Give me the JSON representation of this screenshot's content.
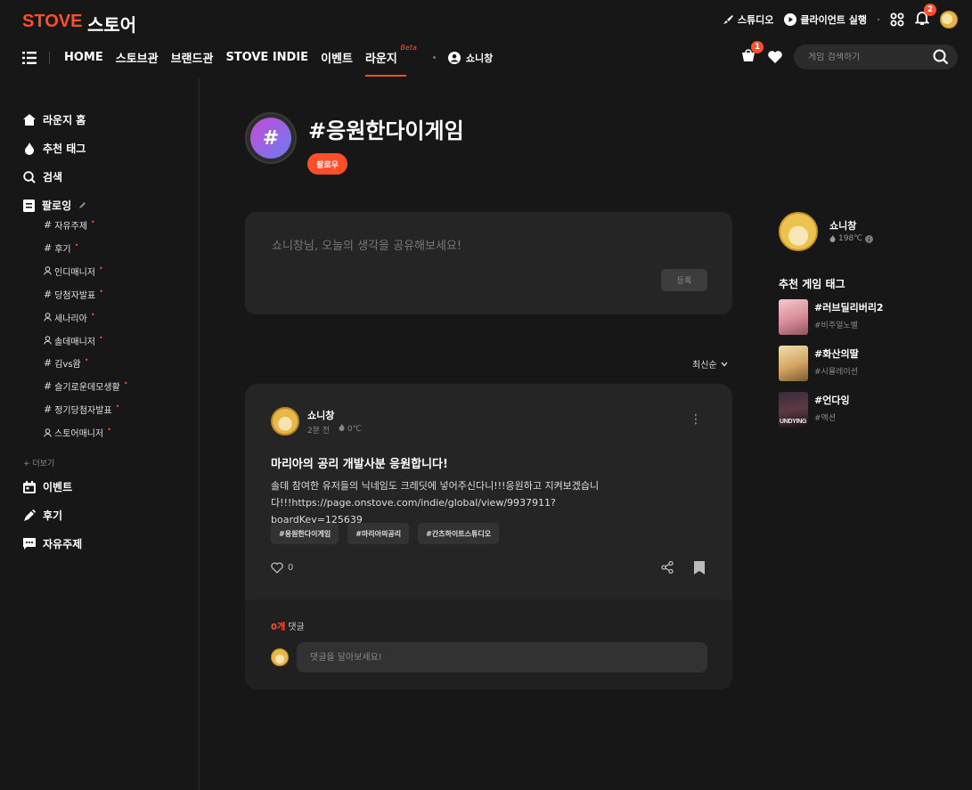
{
  "header": {
    "logo": "STOVE",
    "store": "스토어",
    "studio": "스튜디오",
    "client_run": "클라이언트 실행",
    "notif_count": "2"
  },
  "nav": {
    "items": [
      "HOME",
      "스토브관",
      "브랜드관",
      "STOVE INDIE",
      "이벤트",
      "라운지"
    ],
    "beta": "Beta",
    "user": "쇼니창",
    "cart_count": "1",
    "search_placeholder": "게임 검색하기"
  },
  "sidebar": {
    "main": [
      "라운지 홈",
      "추천 태그",
      "검색",
      "팔로잉"
    ],
    "sub": [
      {
        "prefix": "#",
        "label": "자유주제"
      },
      {
        "prefix": "#",
        "label": "후기"
      },
      {
        "prefix": "user",
        "label": "인디매니저"
      },
      {
        "prefix": "#",
        "label": "당첨자발표"
      },
      {
        "prefix": "user",
        "label": "세나리아"
      },
      {
        "prefix": "user",
        "label": "솔데매니저"
      },
      {
        "prefix": "#",
        "label": "김vs왐"
      },
      {
        "prefix": "#",
        "label": "슬기로운데모생활"
      },
      {
        "prefix": "#",
        "label": "정기당첨자발표"
      },
      {
        "prefix": "user",
        "label": "스토어매니저"
      }
    ],
    "more": "+ 더보기",
    "bottom": [
      "이벤트",
      "후기",
      "자유주제"
    ]
  },
  "tag": {
    "symbol": "#",
    "title": "#응원한다이게임",
    "follow": "팔로우"
  },
  "composer": {
    "placeholder": "쇼니창님, 오늘의 생각을 공유해보세요!",
    "submit": "등록"
  },
  "sort": {
    "label": "최신순"
  },
  "post": {
    "author": "쇼니창",
    "time": "2분 전",
    "temp": "0℃",
    "title": "마리아의 공리 개발사분 응원합니다!",
    "body": "솔데 참여한 유저들의 닉네임도 크레딧에 넣어주신다니!!!응원하고 지켜보겠습니다!!!https://page.onstove.com/indie/global/view/9937911?boardKey=125639",
    "tags": [
      "#응원한다이게임",
      "#마리아의공리",
      "#간츠하이트스튜디오"
    ],
    "likes": "0",
    "comments_count": "0개",
    "comments_label": " 댓글",
    "comment_placeholder": "댓글을 달아보세요!"
  },
  "profile": {
    "name": "쇼니창",
    "temp": "198℃"
  },
  "recommended": {
    "title": "추천 게임 태그",
    "items": [
      {
        "name": "#러브딜리버리2",
        "genre": "#비주얼노벨"
      },
      {
        "name": "#화산의딸",
        "genre": "#시뮬레이션"
      },
      {
        "name": "#언다잉",
        "genre": "#액션"
      }
    ]
  },
  "colors": {
    "accent": "#ff4f28",
    "background": "#171717",
    "card": "#252525"
  }
}
